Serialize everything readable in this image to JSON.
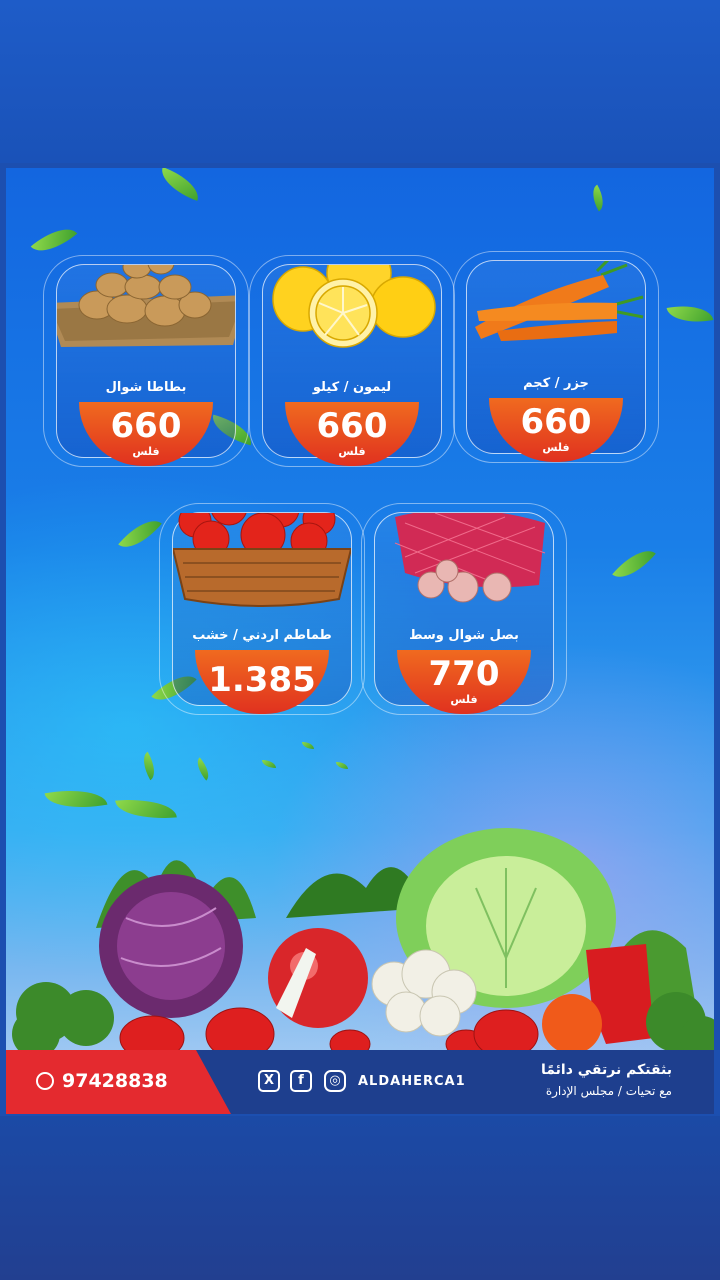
{
  "products": [
    {
      "name": "بطاطا شوال",
      "price": "660",
      "unit": "فلس"
    },
    {
      "name": "ليمون / كيلو",
      "price": "660",
      "unit": "فلس"
    },
    {
      "name": "جزر / كجم",
      "price": "660",
      "unit": "فلس"
    },
    {
      "name": "طماطم اردني / خشب",
      "price": "1.385",
      "unit": ""
    },
    {
      "name": "بصل شوال وسط",
      "price": "770",
      "unit": "فلس"
    }
  ],
  "footer": {
    "phone": "97428838",
    "social_handle": "ALDAHERCA1",
    "slogan": "بثقتكم نرتقي دائمًا",
    "signature": "مع تحيات / مجلس الإدارة"
  },
  "colors": {
    "badge": "#e0311f",
    "footer_bar": "#1e3f8e",
    "phone_box": "#e42a2f",
    "band": "#1c4fb0"
  },
  "icons": [
    "whatsapp-icon",
    "x-icon",
    "facebook-icon",
    "instagram-icon"
  ]
}
